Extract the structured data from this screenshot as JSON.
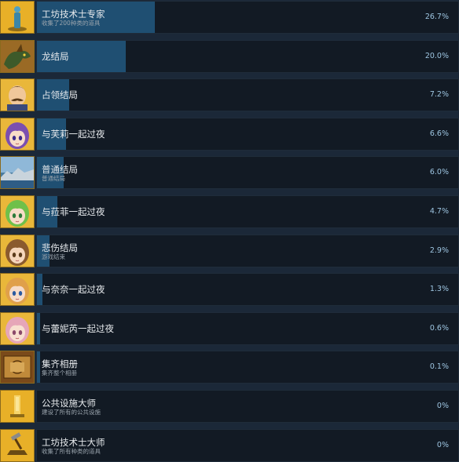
{
  "colors": {
    "background": "#1b2838",
    "row_panel": "#121a24",
    "progress_fill": "#1f4f72",
    "icon_gold": "#e3a91c",
    "title_text": "#e6e9ec",
    "desc_text": "#9aa4ad",
    "percent_text": "#9ec6e2"
  },
  "achievements": [
    {
      "title": "工坊技术士专家",
      "desc": "收集了200种类的道具",
      "percent_label": "26.7%",
      "percent": 26.7,
      "icon": "figurine-award-icon"
    },
    {
      "title": "龙结局",
      "desc": "",
      "percent_label": "20.0%",
      "percent": 20.0,
      "icon": "dragon-portrait-icon"
    },
    {
      "title": "占领结局",
      "desc": "",
      "percent_label": "7.2%",
      "percent": 7.2,
      "icon": "mustached-man-portrait-icon"
    },
    {
      "title": "与芙莉一起过夜",
      "desc": "",
      "percent_label": "6.6%",
      "percent": 6.6,
      "icon": "purple-haired-girl-portrait-icon"
    },
    {
      "title": "普通结局",
      "desc": "普通结局",
      "percent_label": "6.0%",
      "percent": 6.0,
      "icon": "town-landscape-icon"
    },
    {
      "title": "与菈菲一起过夜",
      "desc": "",
      "percent_label": "4.7%",
      "percent": 4.7,
      "icon": "green-haired-girl-portrait-icon"
    },
    {
      "title": "悲伤结局",
      "desc": "游戏结束",
      "percent_label": "2.9%",
      "percent": 2.9,
      "icon": "brown-haired-girl-portrait-icon"
    },
    {
      "title": "与奈奈一起过夜",
      "desc": "",
      "percent_label": "1.3%",
      "percent": 1.3,
      "icon": "orange-haired-girl-portrait-icon"
    },
    {
      "title": "与蕾妮芮一起过夜",
      "desc": "",
      "percent_label": "0.6%",
      "percent": 0.6,
      "icon": "pink-haired-girl-portrait-icon"
    },
    {
      "title": "集齐相册",
      "desc": "集齐整个相册",
      "percent_label": "0.1%",
      "percent": 0.1,
      "icon": "photo-album-icon"
    },
    {
      "title": "公共设施大师",
      "desc": "建设了所有的公共设施",
      "percent_label": "0%",
      "percent": 0,
      "icon": "gold-trophy-icon"
    },
    {
      "title": "工坊技术士大师",
      "desc": "收集了所有种类的道具",
      "percent_label": "0%",
      "percent": 0,
      "icon": "hammer-anvil-icon"
    }
  ]
}
